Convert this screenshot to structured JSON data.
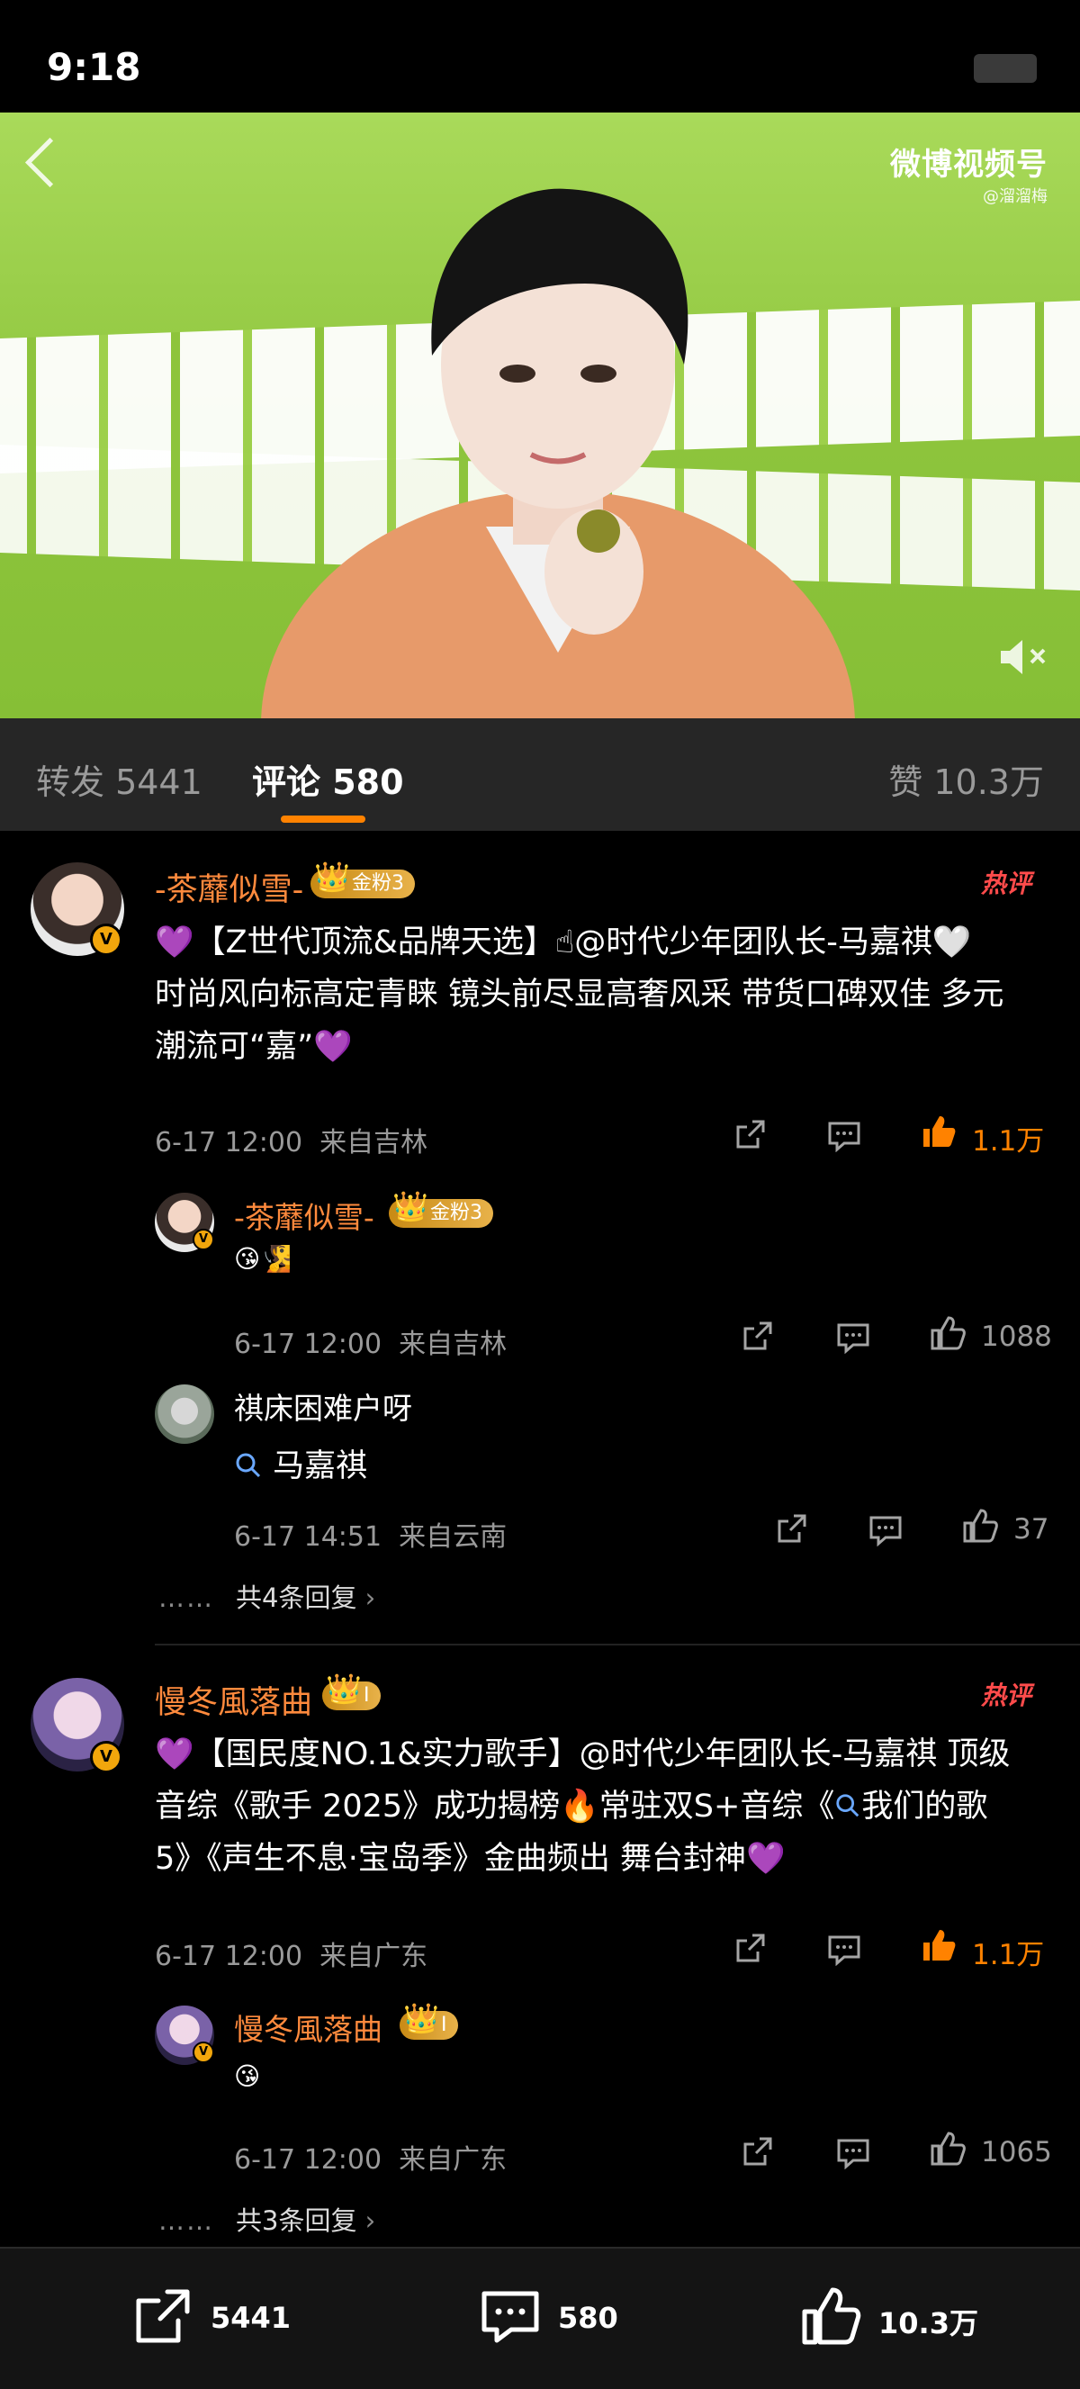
{
  "status_bar": {
    "time": "9:18"
  },
  "video": {
    "logo_text": "微博视频号",
    "logo_handle": "@溜溜梅",
    "mute_icon": "volume-mute-icon"
  },
  "tabs": {
    "repost": "转发 5441",
    "comments": "评论 580",
    "likes": "赞 10.3万"
  },
  "comments": [
    {
      "username": "-茶蘼似雪-",
      "badge": "金粉3",
      "hot_label": "热评",
      "text_line1": "【Z世代顶流&品牌天选】",
      "mention1": "@时代少年团队长-马嘉祺",
      "text_line2": "时尚风向标高定青睐 镜头前尽显高奢风采 带货口碑双佳 多元",
      "text_line3": "潮流可“嘉”",
      "time": "6-17 12:00",
      "location": "来自吉林",
      "likes": "1.1万",
      "replies": [
        {
          "username": "-茶蘼似雪-",
          "badge": "金粉3",
          "text": "😘🧏",
          "time": "6-17 12:00",
          "location": "来自吉林",
          "likes": "1088"
        },
        {
          "username": "祺床困难户呀",
          "text": "马嘉祺",
          "time": "6-17 14:51",
          "location": "来自云南",
          "likes": "37"
        }
      ],
      "more_replies": "共4条回复"
    },
    {
      "username": "慢冬風落曲",
      "badge": "I",
      "hot_label": "热评",
      "text_line1": "【国民度NO.1&实力歌手】@时代少年团队长-马嘉祺 顶级",
      "text_line2": "音综《歌手 2025》成功揭榜🔥常驻双S+音综《",
      "text_line2b": "我们的歌",
      "text_line3": "5》《声生不息·宝岛季》金曲频出 舞台封神",
      "time": "6-17 12:00",
      "location": "来自广东",
      "likes": "1.1万",
      "replies": [
        {
          "username": "慢冬風落曲",
          "badge": "I",
          "text": "😘",
          "time": "6-17 12:00",
          "location": "来自广东",
          "likes": "1065"
        }
      ],
      "more_replies": "共3条回复"
    }
  ],
  "bottom_bar": {
    "repost_count": "5441",
    "comment_count": "580",
    "like_count": "10.3万"
  },
  "colors": {
    "accent": "#ff8200",
    "username": "#ff8a3d",
    "background": "#000000",
    "video_green": "#8dc43c"
  }
}
